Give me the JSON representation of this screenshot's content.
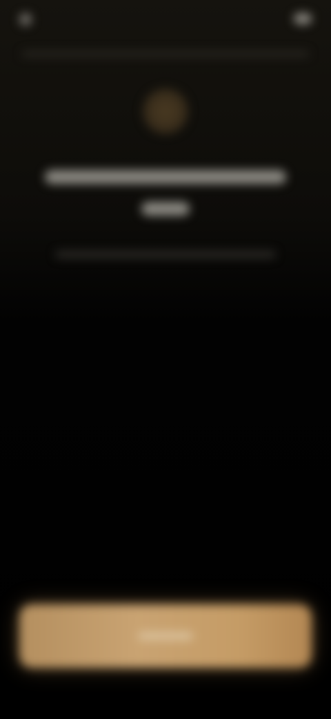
{
  "status_bar": {
    "time_icon": "clock-dot-icon",
    "battery_icon": "battery-icon"
  },
  "header": {
    "avatar_icon": "avatar-icon"
  },
  "content": {
    "headline": "",
    "subtext": ""
  },
  "primary_button": {
    "label": ""
  },
  "colors": {
    "background": "#000000",
    "accent": "#c9a372"
  }
}
